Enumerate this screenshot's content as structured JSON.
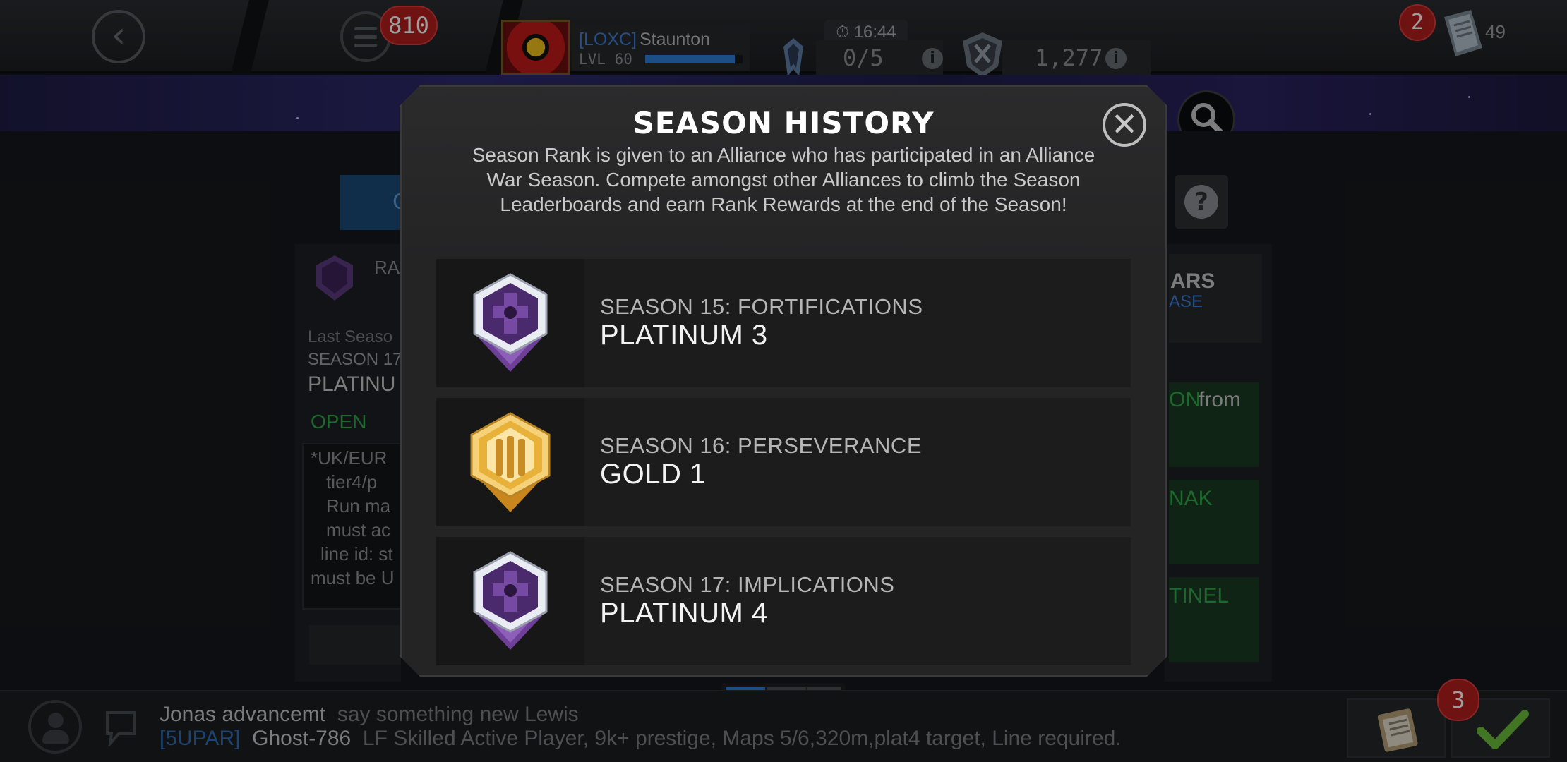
{
  "topbar": {
    "notifications_count": "810",
    "player": {
      "tag": "[LOXC]",
      "name": "Staunton",
      "level": "LVL 60",
      "xp_fraction": 0.92
    },
    "timer": "16:44",
    "war_attempts": "0/5",
    "war_rating": "1,277",
    "alert_count": "2",
    "units": "49"
  },
  "background": {
    "left_panel_lines": [
      "RA",
      "Last Seaso",
      "SEASON 17",
      "PLATINU",
      "OPEN",
      "*UK/EUR",
      "tier4/p",
      "Run ma",
      "must ac",
      "line id: st",
      "must be U"
    ],
    "right_panel_lines": [
      "ARS",
      "ASE",
      "ON",
      "from",
      "NAK",
      "TINEL"
    ]
  },
  "chat": {
    "line1_user": "Jonas advancemt",
    "line1_msg": "say something new Lewis",
    "line2_tag": "[5UPAR]",
    "line2_user": "Ghost-786",
    "line2_msg": "LF Skilled Active Player, 9k+ prestige, Maps 5/6,320m,plat4 target, Line required.",
    "check_badge": "3"
  },
  "modal": {
    "title": "SEASON HISTORY",
    "close_icon": "close-icon",
    "description": "Season Rank is given to an Alliance who has participated in an Alliance War Season. Compete amongst other Alliances to climb the Season Leaderboards and earn Rank Rewards at the end of the Season!",
    "seasons": [
      {
        "name": "SEASON 15: FORTIFICATIONS",
        "rank": "PLATINUM 3",
        "badge": "platinum-badge-icon"
      },
      {
        "name": "SEASON 16: PERSEVERANCE",
        "rank": "GOLD 1",
        "badge": "gold-badge-icon"
      },
      {
        "name": "SEASON 17: IMPLICATIONS",
        "rank": "PLATINUM 4",
        "badge": "platinum-badge-icon"
      }
    ]
  },
  "colors": {
    "accent_blue": "#2d7fd6",
    "badge_red": "#b41e1e",
    "platinum_purple": "#6d3f96",
    "gold": "#e8b13a",
    "open_green": "#2ea84a"
  }
}
